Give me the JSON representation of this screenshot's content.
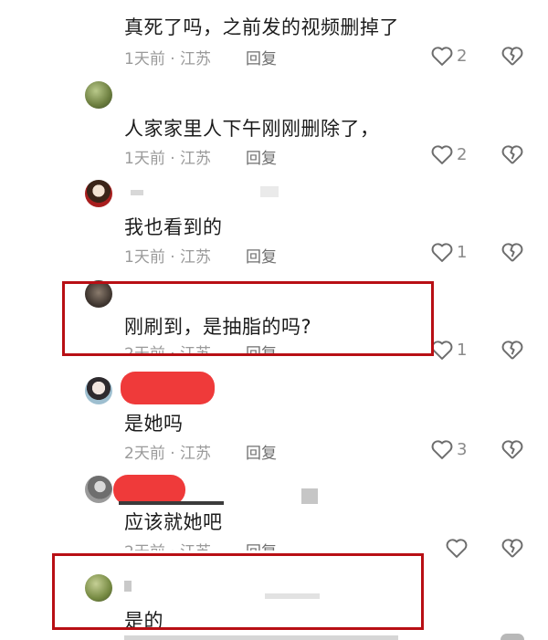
{
  "comments": [
    {
      "text": "真死了吗，之前发的视频删掉了",
      "meta": "1天前 · 江苏",
      "reply": "回复",
      "likes": "2"
    },
    {
      "text": "人家家里人下午刚刚删除了，",
      "meta": "1天前 · 江苏",
      "reply": "回复",
      "likes": "2"
    },
    {
      "text": "我也看到的",
      "meta": "1天前 · 江苏",
      "reply": "回复",
      "likes": "1"
    },
    {
      "text": "刚刷到，是抽脂的吗?",
      "meta": "2天前 · 江苏",
      "reply": "回复",
      "likes": "1"
    },
    {
      "text": "是她吗",
      "meta": "2天前 · 江苏",
      "reply": "回复",
      "likes": "3"
    },
    {
      "text": "应该就她吧",
      "meta": "2天前 · 江苏",
      "reply": "回复",
      "likes": ""
    },
    {
      "text": "是的",
      "meta": "",
      "reply": "",
      "likes": ""
    }
  ],
  "icons": {
    "like": "heart-icon",
    "dislike": "broken-heart-icon"
  },
  "colors": {
    "highlight_frame": "#b80f14",
    "redaction": "#ef3a3a",
    "text": "#1c1c1c",
    "meta": "#9a9a9a"
  }
}
